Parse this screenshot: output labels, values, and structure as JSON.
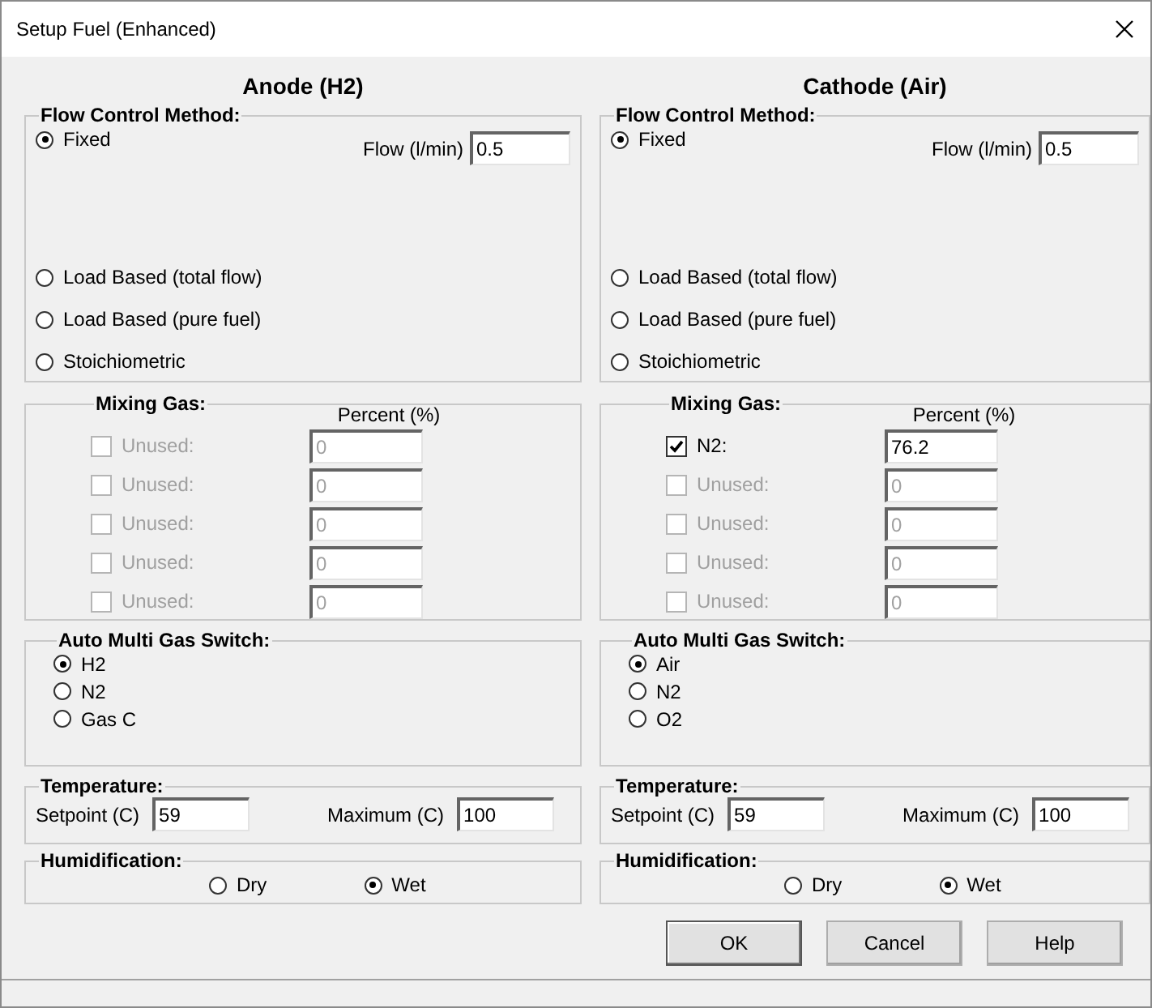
{
  "window": {
    "title": "Setup Fuel (Enhanced)"
  },
  "panels": [
    {
      "heading": "Anode (H2)",
      "flow_control": {
        "title": "Flow Control Method:",
        "flow_label": "Flow (l/min)",
        "flow_value": "0.5",
        "methods": [
          {
            "label": "Fixed",
            "selected": true
          },
          {
            "label": "Load Based (total flow)",
            "selected": false
          },
          {
            "label": "Load Based (pure fuel)",
            "selected": false
          },
          {
            "label": "Stoichiometric",
            "selected": false
          }
        ]
      },
      "mixing_gas": {
        "title": "Mixing Gas:",
        "percent_header": "Percent (%)",
        "gases": [
          {
            "label": "Unused:",
            "checked": false,
            "disabled": true,
            "value": "0"
          },
          {
            "label": "Unused:",
            "checked": false,
            "disabled": true,
            "value": "0"
          },
          {
            "label": "Unused:",
            "checked": false,
            "disabled": true,
            "value": "0"
          },
          {
            "label": "Unused:",
            "checked": false,
            "disabled": true,
            "value": "0"
          },
          {
            "label": "Unused:",
            "checked": false,
            "disabled": true,
            "value": "0"
          }
        ]
      },
      "auto_switch": {
        "title": "Auto Multi Gas Switch:",
        "options": [
          {
            "label": "H2",
            "selected": true
          },
          {
            "label": "N2",
            "selected": false
          },
          {
            "label": "Gas C",
            "selected": false
          }
        ]
      },
      "temperature": {
        "title": "Temperature:",
        "setpoint_label": "Setpoint (C)",
        "setpoint_value": "59",
        "maximum_label": "Maximum (C)",
        "maximum_value": "100"
      },
      "humidification": {
        "title": "Humidification:",
        "options": [
          {
            "label": "Dry",
            "selected": false
          },
          {
            "label": "Wet",
            "selected": true
          }
        ]
      }
    },
    {
      "heading": "Cathode (Air)",
      "flow_control": {
        "title": "Flow Control Method:",
        "flow_label": "Flow (l/min)",
        "flow_value": "0.5",
        "methods": [
          {
            "label": "Fixed",
            "selected": true
          },
          {
            "label": "Load Based (total flow)",
            "selected": false
          },
          {
            "label": "Load Based (pure fuel)",
            "selected": false
          },
          {
            "label": "Stoichiometric",
            "selected": false
          }
        ]
      },
      "mixing_gas": {
        "title": "Mixing Gas:",
        "percent_header": "Percent (%)",
        "gases": [
          {
            "label": "N2:",
            "checked": true,
            "disabled": false,
            "value": "76.2"
          },
          {
            "label": "Unused:",
            "checked": false,
            "disabled": true,
            "value": "0"
          },
          {
            "label": "Unused:",
            "checked": false,
            "disabled": true,
            "value": "0"
          },
          {
            "label": "Unused:",
            "checked": false,
            "disabled": true,
            "value": "0"
          },
          {
            "label": "Unused:",
            "checked": false,
            "disabled": true,
            "value": "0"
          }
        ]
      },
      "auto_switch": {
        "title": "Auto Multi Gas Switch:",
        "options": [
          {
            "label": "Air",
            "selected": true
          },
          {
            "label": "N2",
            "selected": false
          },
          {
            "label": "O2",
            "selected": false
          }
        ]
      },
      "temperature": {
        "title": "Temperature:",
        "setpoint_label": "Setpoint (C)",
        "setpoint_value": "59",
        "maximum_label": "Maximum (C)",
        "maximum_value": "100"
      },
      "humidification": {
        "title": "Humidification:",
        "options": [
          {
            "label": "Dry",
            "selected": false
          },
          {
            "label": "Wet",
            "selected": true
          }
        ]
      }
    }
  ],
  "buttons": [
    {
      "label": "OK",
      "default": true
    },
    {
      "label": "Cancel",
      "default": false
    },
    {
      "label": "Help",
      "default": false
    }
  ]
}
